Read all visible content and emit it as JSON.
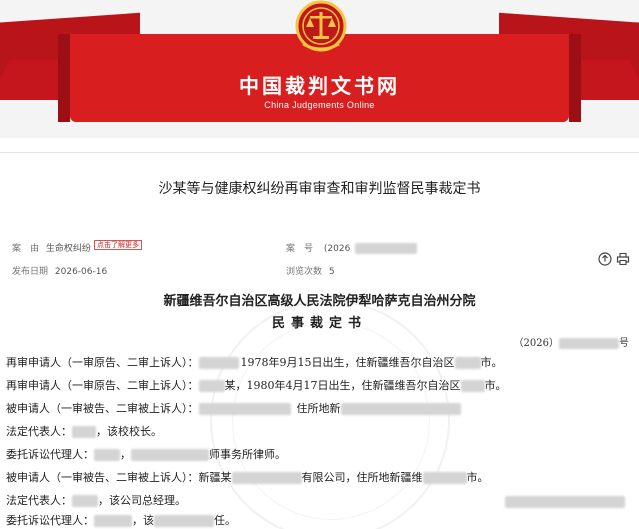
{
  "header": {
    "site_title": "中国裁判文书网",
    "site_subtitle": "China Judgements Online",
    "emblem_icon": "court-emblem-icon",
    "brand_red": "#d81e1e"
  },
  "document": {
    "title": "沙某等与健康权纠纷再审审查和审判监督民事裁定书",
    "meta": {
      "cause_label": "案　由",
      "cause_value": "生命权纠纷",
      "cause_tag": "点击了解更多",
      "case_label": "案　号",
      "case_value_prefix": "(2026",
      "date_label": "发布日期",
      "date_value": "2026-06-16",
      "views_label": "浏览次数",
      "views_value": "5"
    },
    "icons": [
      "share-icon",
      "print-icon"
    ],
    "court_name": "新疆维吾尔自治区高级人民法院伊犁哈萨克自治州分院",
    "doc_kind": "民事裁定书",
    "case_number_prefix": "（2026）",
    "case_number_suffix": "号",
    "parties": [
      {
        "pre": "再审申请人（一审原告、二审上诉人）：",
        "mid": "1978年9月15日出生，住新疆维吾尔自治区",
        "post": "市。"
      },
      {
        "pre": "再审申请人（一审原告、二审上诉人）：",
        "mid": "某，1980年4月17日出生，住新疆维吾尔自治区",
        "post": "市。"
      },
      {
        "pre": "被申请人（一审被告、二审被上诉人）：",
        "mid": "住所地新",
        "post": ""
      },
      {
        "pre": "法定代表人：",
        "mid": "，该校校长。",
        "post": ""
      },
      {
        "pre": "委托诉讼代理人：",
        "mid": "，",
        "post": "师事务所律师。"
      },
      {
        "pre": "被申请人（一审被告、二审被上诉人）：",
        "mid": "新疆某",
        "post": "有限公司，住所地新疆维",
        "post2": "市。"
      },
      {
        "pre": "法定代表人：",
        "mid": "，该公司总经理。",
        "post": ""
      },
      {
        "pre": "委托诉讼代理人：",
        "mid": "，该",
        "post": "任。"
      }
    ]
  }
}
